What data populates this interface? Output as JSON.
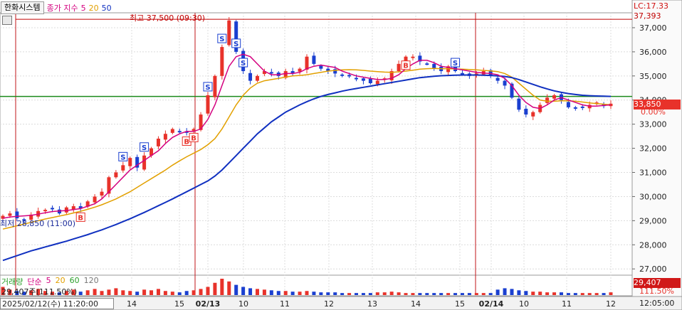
{
  "toolbar": {
    "stock_name": "한화시스템",
    "ma_label": "종가 지수",
    "ma_periods": [
      "5",
      "20",
      "50"
    ],
    "ma_colors": [
      "#d4007f",
      "#e2a000",
      "#1030c0"
    ]
  },
  "price_axis": {
    "ticks": [
      "37,000",
      "36,000",
      "35,000",
      "34,000",
      "33,000",
      "32,000",
      "31,000",
      "30,000",
      "29,000",
      "28,000",
      "27,000"
    ],
    "lc_label": "LC:17.33",
    "high_box": "37,393",
    "current_box": "33,850",
    "current_pct": "0.00%"
  },
  "annotations": {
    "high": "최고 37,500 (09:30)",
    "low": "최저 28,850 (11:00)"
  },
  "volume": {
    "legend_label": "거래량",
    "legend_ma": "단순",
    "ma_periods": [
      "5",
      "20",
      "60",
      "120"
    ],
    "ma_colors": [
      "#d4007f",
      "#e2a000",
      "#2ca02c",
      "#777777"
    ],
    "summary": "29,407주(111.50%)",
    "box_value": "29,407",
    "box_pct": "111.50%"
  },
  "time_axis": {
    "crosshair_date": "2025/02/12(수) 11:20:00",
    "ticks": [
      "14",
      "15",
      "02/13",
      "10",
      "11",
      "12",
      "13",
      "14",
      "15",
      "02/14",
      "10",
      "11",
      "12"
    ],
    "crosshair_time": "12:05:00"
  },
  "colors": {
    "up": "#e8322a",
    "down": "#1a3fd0",
    "grid": "#dcdcdc",
    "green_line": "#1b8a1b",
    "divider": "#c0151a"
  },
  "chart_data": {
    "type": "candlestick",
    "title": "",
    "x_sessions": [
      "2025/02/12",
      "02/13",
      "02/14"
    ],
    "ylim": [
      26800,
      37500
    ],
    "horizontal_line": 34150,
    "high": {
      "value": 37500,
      "time": "09:30"
    },
    "low": {
      "value": 28850,
      "time": "11:00"
    },
    "close_series": [
      29200,
      29300,
      29100,
      29000,
      29250,
      29400,
      29450,
      29500,
      29300,
      29550,
      29600,
      29500,
      29800,
      30000,
      30200,
      30800,
      31000,
      31300,
      31600,
      31200,
      31700,
      32000,
      32400,
      32600,
      32800,
      32700,
      32650,
      32800,
      33400,
      34200,
      35000,
      36200,
      37300,
      36000,
      35200,
      34800,
      35000,
      35200,
      35100,
      35000,
      35200,
      35100,
      35300,
      35800,
      35500,
      35300,
      35200,
      35100,
      35000,
      35000,
      34900,
      34800,
      34700,
      34800,
      34900,
      35200,
      35500,
      35800,
      35800,
      35600,
      35500,
      35300,
      35200,
      35400,
      35200,
      35100,
      35000,
      35100,
      35200,
      35000,
      34800,
      34600,
      34100,
      33600,
      33400,
      33500,
      33800,
      34100,
      34200,
      34000,
      33700,
      33650,
      33700,
      33800,
      33900,
      33750,
      33850
    ],
    "ma5_series": [
      29100,
      29150,
      29180,
      29200,
      29220,
      29270,
      29330,
      29380,
      29400,
      29420,
      29460,
      29500,
      29600,
      29700,
      29900,
      30200,
      30500,
      30800,
      31100,
      31300,
      31500,
      31700,
      31900,
      32200,
      32450,
      32600,
      32700,
      32700,
      32800,
      33200,
      33800,
      34600,
      35400,
      35800,
      35900,
      35800,
      35500,
      35200,
      35050,
      35050,
      35100,
      35100,
      35150,
      35300,
      35400,
      35450,
      35400,
      35350,
      35200,
      35100,
      35000,
      34950,
      34900,
      34850,
      34850,
      34900,
      35050,
      35300,
      35500,
      35650,
      35650,
      35550,
      35400,
      35350,
      35300,
      35250,
      35200,
      35150,
      35120,
      35100,
      35050,
      34900,
      34600,
      34200,
      33900,
      33700,
      33650,
      33800,
      34000,
      34100,
      34000,
      33900,
      33800,
      33750,
      33750,
      33780,
      33800
    ],
    "ma20_series": [
      28650,
      28720,
      28790,
      28860,
      28930,
      29000,
      29070,
      29130,
      29190,
      29250,
      29320,
      29390,
      29470,
      29560,
      29660,
      29780,
      29900,
      30050,
      30200,
      30380,
      30560,
      30740,
      30920,
      31100,
      31300,
      31480,
      31650,
      31800,
      31950,
      32150,
      32400,
      32800,
      33300,
      33800,
      34200,
      34500,
      34700,
      34800,
      34850,
      34900,
      34950,
      35000,
      35020,
      35050,
      35100,
      35150,
      35200,
      35230,
      35250,
      35260,
      35250,
      35230,
      35200,
      35180,
      35160,
      35150,
      35170,
      35200,
      35240,
      35280,
      35300,
      35310,
      35300,
      35300,
      35290,
      35280,
      35270,
      35250,
      35230,
      35210,
      35180,
      35100,
      34950,
      34700,
      34450,
      34200,
      34000,
      33950,
      33950,
      33970,
      33970,
      33950,
      33920,
      33880,
      33850,
      33830,
      33800
    ],
    "ma50_series": [
      27350,
      27450,
      27550,
      27650,
      27750,
      27830,
      27910,
      27990,
      28070,
      28150,
      28240,
      28330,
      28420,
      28520,
      28620,
      28730,
      28840,
      28960,
      29080,
      29210,
      29340,
      29480,
      29620,
      29760,
      29900,
      30050,
      30200,
      30350,
      30500,
      30650,
      30850,
      31100,
      31400,
      31700,
      32000,
      32300,
      32600,
      32850,
      33100,
      33300,
      33500,
      33650,
      33800,
      33930,
      34050,
      34150,
      34230,
      34300,
      34370,
      34430,
      34480,
      34530,
      34580,
      34630,
      34680,
      34730,
      34780,
      34830,
      34880,
      34930,
      34960,
      34990,
      35010,
      35020,
      35030,
      35040,
      35040,
      35040,
      35030,
      35020,
      35000,
      34980,
      34930,
      34850,
      34750,
      34650,
      34550,
      34460,
      34380,
      34320,
      34270,
      34230,
      34200,
      34180,
      34170,
      34160,
      34150
    ],
    "signals": [
      {
        "label": "B",
        "index": 11
      },
      {
        "label": "S",
        "index": 17
      },
      {
        "label": "S",
        "index": 20
      },
      {
        "label": "B",
        "index": 26
      },
      {
        "label": "B",
        "index": 27
      },
      {
        "label": "S",
        "index": 29
      },
      {
        "label": "S",
        "index": 31
      },
      {
        "label": "S",
        "index": 33
      },
      {
        "label": "S",
        "index": 34
      },
      {
        "label": "B",
        "index": 57
      },
      {
        "label": "S",
        "index": 64
      }
    ],
    "volume_series": [
      12,
      8,
      6,
      5,
      7,
      9,
      6,
      5,
      4,
      6,
      8,
      5,
      7,
      9,
      6,
      8,
      10,
      7,
      6,
      5,
      8,
      7,
      9,
      6,
      5,
      4,
      6,
      7,
      9,
      12,
      18,
      24,
      20,
      15,
      12,
      10,
      9,
      8,
      7,
      6,
      6,
      5,
      5,
      6,
      5,
      4,
      4,
      4,
      3,
      3,
      3,
      3,
      3,
      4,
      4,
      5,
      4,
      3,
      3,
      3,
      3,
      3,
      3,
      3,
      3,
      3,
      3,
      3,
      3,
      3,
      8,
      10,
      9,
      7,
      6,
      5,
      5,
      4,
      4,
      4,
      3,
      3,
      3,
      3,
      3,
      3,
      4
    ]
  }
}
